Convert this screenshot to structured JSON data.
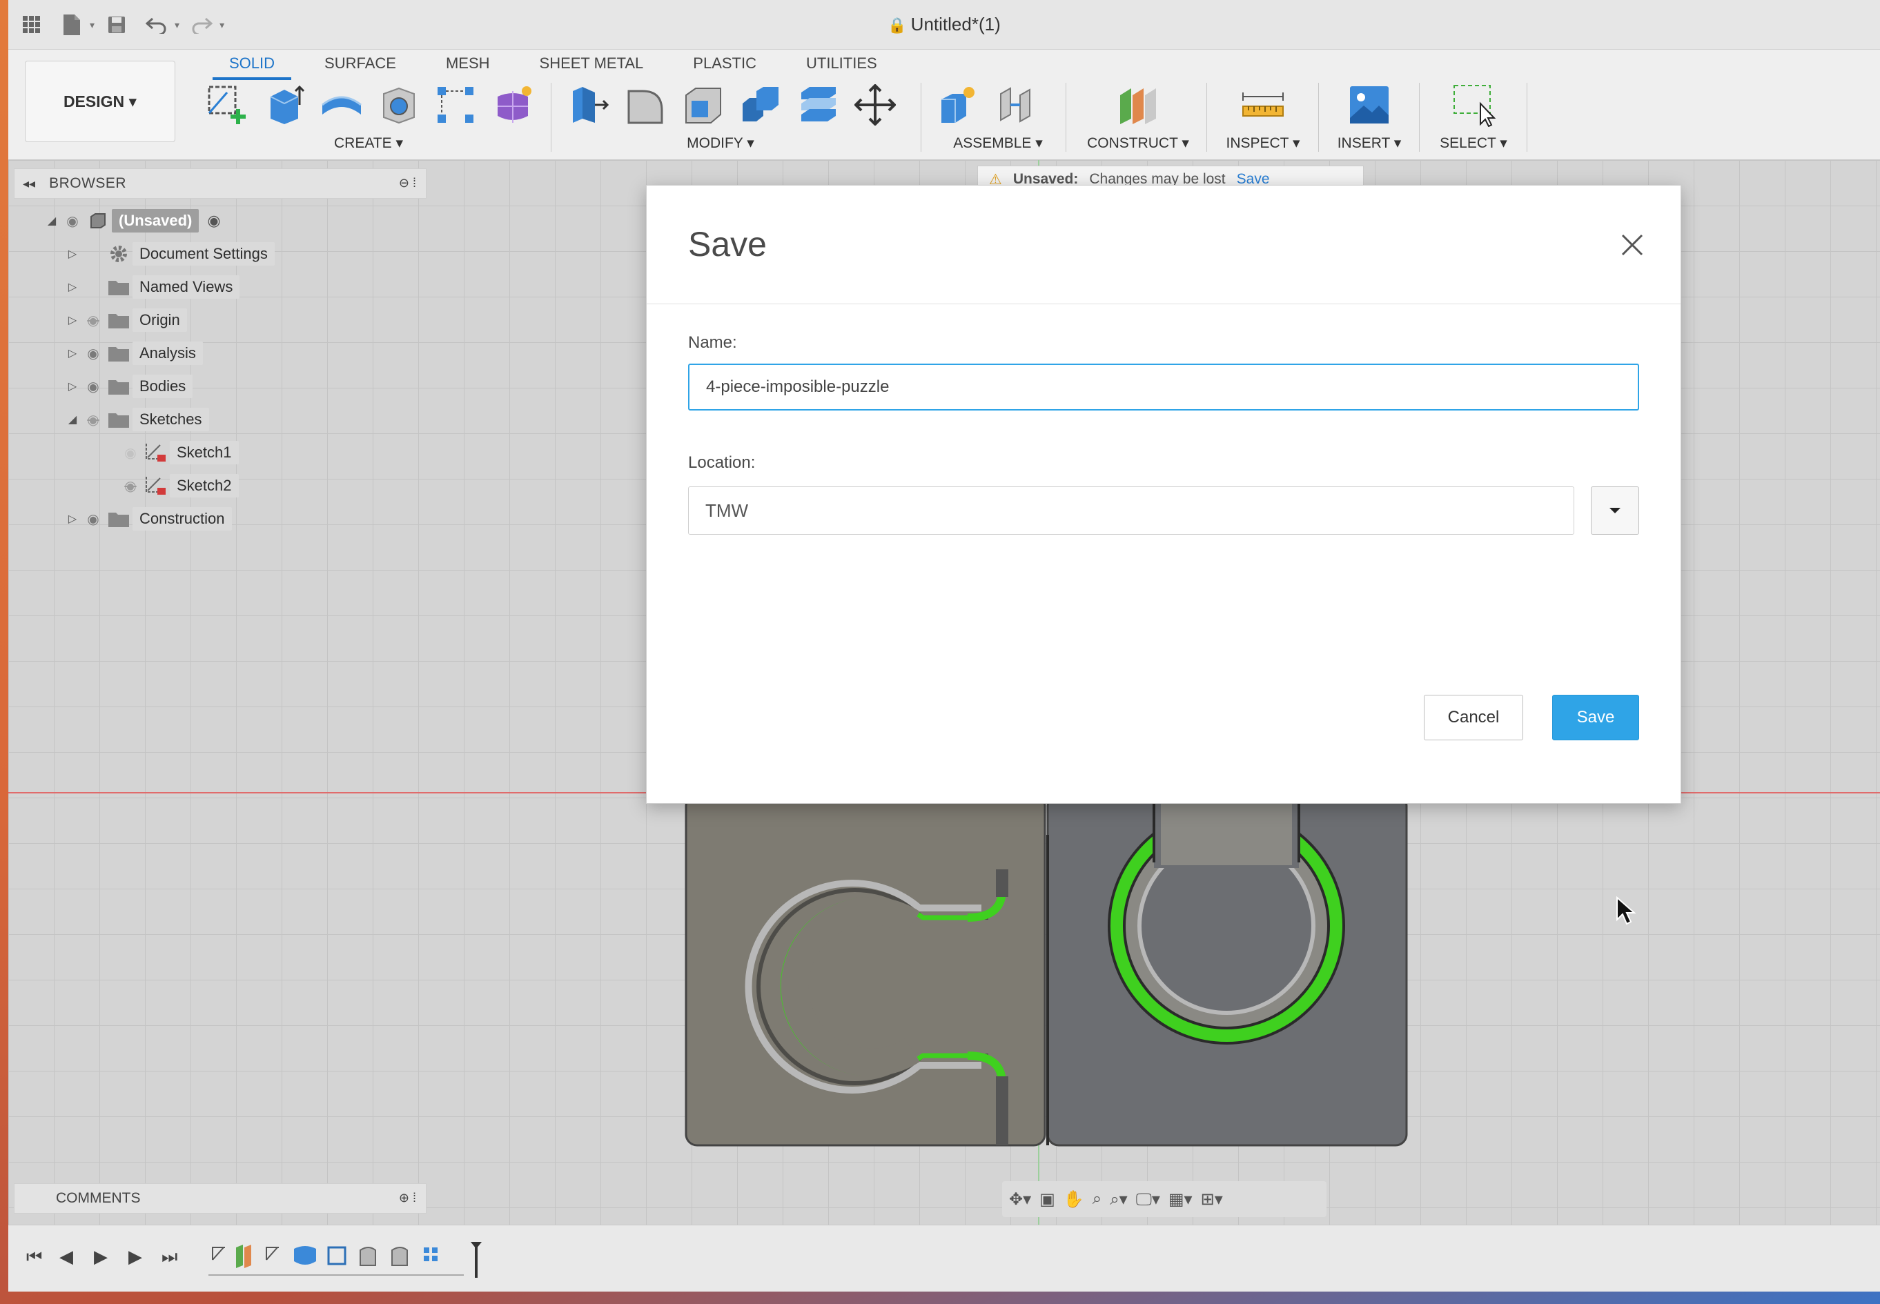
{
  "window": {
    "document_title": "Untitled*(1)"
  },
  "ribbon": {
    "workspace_label": "DESIGN ▾",
    "tabs": [
      "SOLID",
      "SURFACE",
      "MESH",
      "SHEET METAL",
      "PLASTIC",
      "UTILITIES"
    ],
    "active_tab": "SOLID",
    "groups": {
      "create": "CREATE ▾",
      "modify": "MODIFY ▾",
      "assemble": "ASSEMBLE ▾",
      "construct": "CONSTRUCT ▾",
      "inspect": "INSPECT ▾",
      "insert": "INSERT ▾",
      "select": "SELECT ▾"
    }
  },
  "browser": {
    "title": "BROWSER",
    "root": "(Unsaved)",
    "items": [
      {
        "label": "Document Settings"
      },
      {
        "label": "Named Views"
      },
      {
        "label": "Origin"
      },
      {
        "label": "Analysis"
      },
      {
        "label": "Bodies"
      },
      {
        "label": "Sketches"
      },
      {
        "label": "Sketch1"
      },
      {
        "label": "Sketch2"
      },
      {
        "label": "Construction"
      }
    ]
  },
  "notice": {
    "status": "Unsaved:",
    "message": "Changes may be lost",
    "action": "Save"
  },
  "comments": {
    "title": "COMMENTS"
  },
  "dialog": {
    "title": "Save",
    "name_label": "Name:",
    "name_value": "4-piece-imposible-puzzle",
    "location_label": "Location:",
    "location_value": "TMW",
    "cancel_label": "Cancel",
    "save_label": "Save"
  },
  "colors": {
    "accent": "#2fa4e7",
    "active_tab": "#1d74c9",
    "highlight_green": "#3fd01f"
  }
}
